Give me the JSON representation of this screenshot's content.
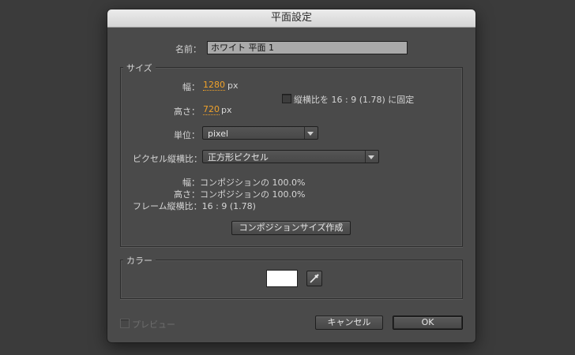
{
  "dialog": {
    "title": "平面設定",
    "name_label": "名前：",
    "name_value": "ホワイト 平面 1"
  },
  "size": {
    "group_title": "サイズ",
    "width_label": "幅：",
    "width_value": "1280",
    "width_unit": "px",
    "height_label": "高さ：",
    "height_value": "720",
    "height_unit": "px",
    "lock_aspect_label": "縦横比を 16 : 9 (1.78) に固定",
    "lock_aspect_checked": false,
    "unit_label": "単位：",
    "unit_value": "pixel",
    "pixel_aspect_label": "ピクセル縦横比：",
    "pixel_aspect_value": "正方形ピクセル",
    "info_width": "幅：コンポジションの 100.0%",
    "info_height": "高さ：コンポジションの 100.0%",
    "info_frame": "フレーム縦横比：16 : 9 (1.78)",
    "make_comp_size_button": "コンポジションサイズ作成"
  },
  "color": {
    "group_title": "カラー",
    "swatch_color": "#ffffff"
  },
  "footer": {
    "preview_label": "プレビュー",
    "preview_checked": false,
    "cancel_button": "キャンセル",
    "ok_button": "OK"
  },
  "colors": {
    "background": "#3b3b3b",
    "dialog": "#4a4a4a",
    "accent_number": "#f0a22a"
  }
}
